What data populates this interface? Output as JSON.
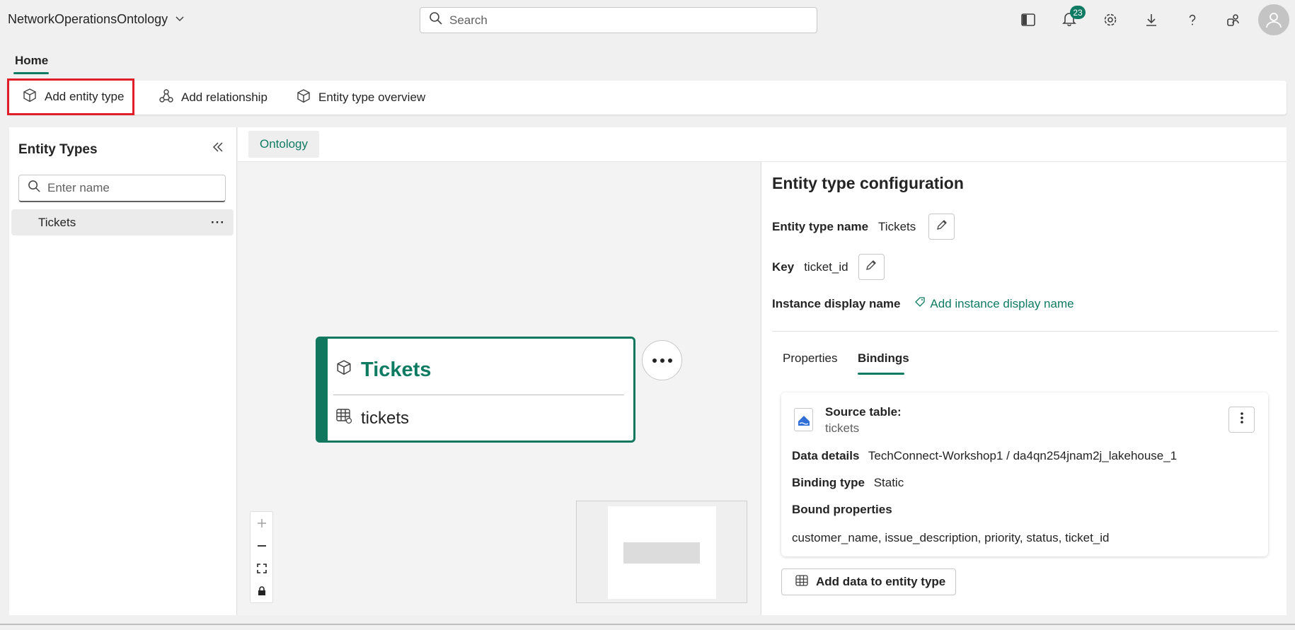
{
  "app": {
    "title": "NetworkOperationsOntology"
  },
  "search": {
    "placeholder": "Search"
  },
  "notifications": {
    "count": "23"
  },
  "home_tab": {
    "label": "Home"
  },
  "toolbar": {
    "add_entity_type": "Add entity type",
    "add_relationship": "Add relationship",
    "entity_type_overview": "Entity type overview"
  },
  "entity_types": {
    "title": "Entity Types",
    "filter_placeholder": "Enter name",
    "items": [
      {
        "label": "Tickets",
        "more": "···"
      }
    ]
  },
  "canvas": {
    "tab_label": "Ontology",
    "node": {
      "title": "Tickets",
      "table": "tickets"
    }
  },
  "config": {
    "title": "Entity type configuration",
    "name_label": "Entity type name",
    "name_value": "Tickets",
    "key_label": "Key",
    "key_value": "ticket_id",
    "display_name_label": "Instance display name",
    "display_name_link": "Add instance display name",
    "tabs": {
      "properties": "Properties",
      "bindings": "Bindings"
    },
    "binding": {
      "source_label": "Source table:",
      "source_value": "tickets",
      "data_details_label": "Data details",
      "data_details_value": "TechConnect-Workshop1 / da4qn254jnam2j_lakehouse_1",
      "binding_type_label": "Binding type",
      "binding_type_value": "Static",
      "bound_properties_label": "Bound properties",
      "bound_properties_value": "customer_name, issue_description, priority, status, ticket_id"
    },
    "add_data_label": "Add data to entity type"
  },
  "colors": {
    "accent": "#0f7b63",
    "highlight": "#e01e2a"
  }
}
